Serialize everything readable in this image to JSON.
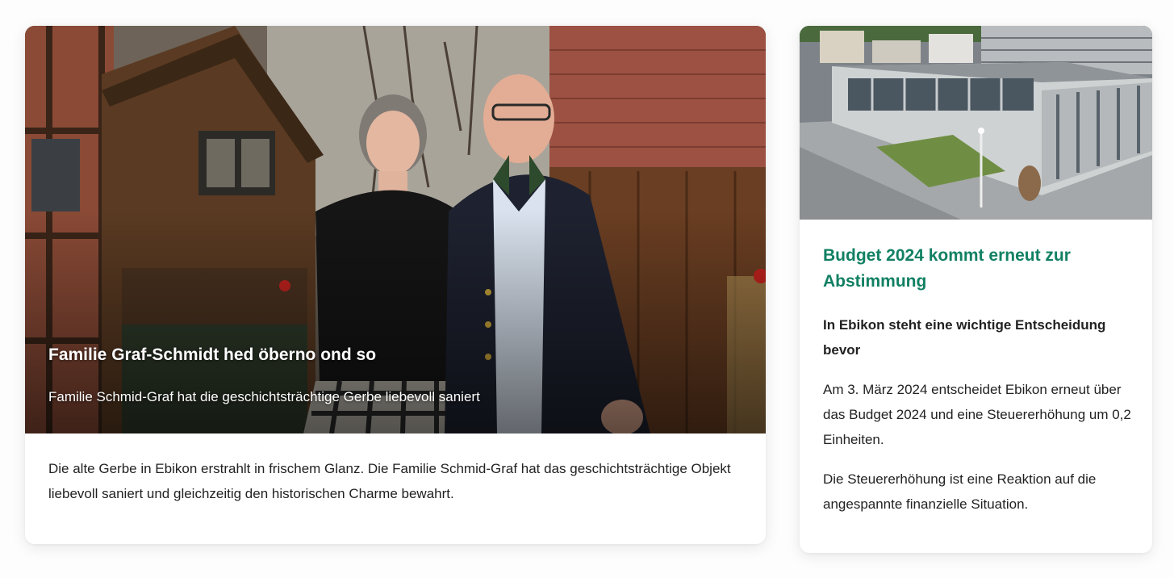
{
  "feature": {
    "title": "Familie Graf-Schmidt hed öberno ond so",
    "subtitle": "Familie Schmid-Graf hat die geschichtsträchtige Gerbe liebevoll saniert",
    "body": "Die alte Gerbe in Ebikon erstrahlt in frischem Glanz. Die Familie Schmid-Graf hat das geschichtsträchtige Objekt liebevoll saniert und gleichzeitig den historischen Charme bewahrt."
  },
  "article": {
    "title": "Budget 2024 kommt erneut zur Abstimmung",
    "lead": "In Ebikon steht eine wichtige Entscheidung bevor",
    "paragraphs": [
      "Am 3. März 2024 entscheidet Ebikon erneut über das Budget 2024 und eine Steuererhöhung um 0,2 Einheiten.",
      "Die Steuererhöhung ist eine Reaktion auf die angespannte finanzielle Situation."
    ]
  },
  "colors": {
    "accent": "#118063",
    "text": "#222222",
    "background": "#fdfdfd"
  }
}
